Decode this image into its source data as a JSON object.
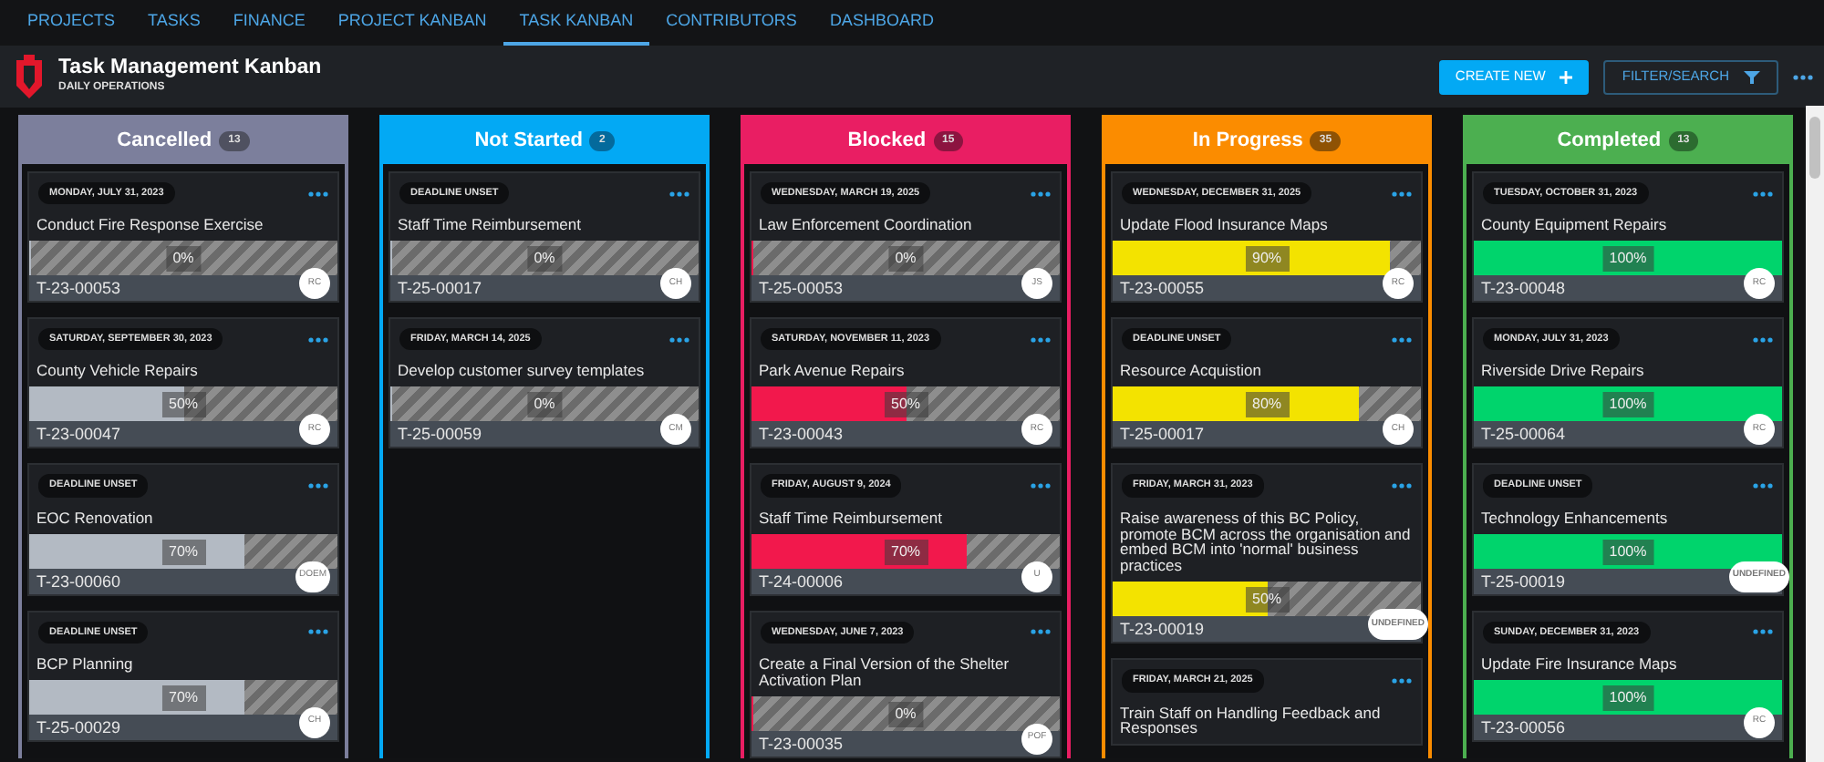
{
  "nav": {
    "tabs": [
      {
        "label": "PROJECTS",
        "selected": false
      },
      {
        "label": "TASKS",
        "selected": false
      },
      {
        "label": "FINANCE",
        "selected": false
      },
      {
        "label": "PROJECT KANBAN",
        "selected": false
      },
      {
        "label": "TASK KANBAN",
        "selected": true
      },
      {
        "label": "CONTRIBUTORS",
        "selected": false
      },
      {
        "label": "DASHBOARD",
        "selected": false
      }
    ]
  },
  "header": {
    "title": "Task Management Kanban",
    "subtitle": "DAILY OPERATIONS",
    "create_button": "CREATE NEW",
    "filter_button": "FILTER/SEARCH"
  },
  "columns": [
    {
      "name": "Cancelled",
      "count": "13",
      "color": "#7c7f9c",
      "kind": "cancelled",
      "cards": [
        {
          "date": "MONDAY, JULY 31, 2023",
          "title": "Conduct Fire Response Exercise",
          "level": 0,
          "percent": "0%",
          "id": "T-23-00053",
          "avatar": "RC"
        },
        {
          "date": "SATURDAY, SEPTEMBER 30, 2023",
          "title": "County Vehicle Repairs",
          "level": 0.5,
          "percent": "50%",
          "id": "T-23-00047",
          "avatar": "RC"
        },
        {
          "date": "DEADLINE UNSET",
          "title": "EOC Renovation",
          "level": 0.7,
          "percent": "70%",
          "id": "T-23-00060",
          "avatar": "DOEM"
        },
        {
          "date": "DEADLINE UNSET",
          "title": "BCP Planning",
          "level": 0.7,
          "percent": "70%",
          "id": "T-25-00029",
          "avatar": "CH"
        }
      ]
    },
    {
      "name": "Not Started",
      "count": "2",
      "color": "#03a9f4",
      "kind": "not_started",
      "cards": [
        {
          "date": "DEADLINE UNSET",
          "title": "Staff Time Reimbursement",
          "level": 0,
          "percent": "0%",
          "id": "T-25-00017",
          "avatar": "CH"
        },
        {
          "date": "FRIDAY, MARCH 14, 2025",
          "title": "Develop customer survey templates",
          "level": 0,
          "percent": "0%",
          "id": "T-25-00059",
          "avatar": "CM"
        }
      ]
    },
    {
      "name": "Blocked",
      "count": "15",
      "color": "#e91e63",
      "kind": "blocked",
      "cards": [
        {
          "date": "WEDNESDAY, MARCH 19, 2025",
          "title": "Law Enforcement Coordination",
          "level": 0,
          "percent": "0%",
          "id": "T-25-00053",
          "avatar": "JS"
        },
        {
          "date": "SATURDAY, NOVEMBER 11, 2023",
          "title": "Park Avenue Repairs",
          "level": 0.5,
          "percent": "50%",
          "id": "T-23-00043",
          "avatar": "RC"
        },
        {
          "date": "FRIDAY, AUGUST 9, 2024",
          "title": "Staff Time Reimbursement",
          "level": 0.7,
          "percent": "70%",
          "id": "T-24-00006",
          "avatar": "U"
        },
        {
          "date": "WEDNESDAY, JUNE 7, 2023",
          "title": "Create a Final Version of the Shelter Activation Plan",
          "level": 0,
          "percent": "0%",
          "id": "T-23-00035",
          "avatar": "POF"
        }
      ]
    },
    {
      "name": "In Progress",
      "count": "35",
      "color": "#fb8c00",
      "kind": "in_progress",
      "cards": [
        {
          "date": "WEDNESDAY, DECEMBER 31, 2025",
          "title": "Update Flood Insurance Maps",
          "level": 0.9,
          "percent": "90%",
          "id": "T-23-00055",
          "avatar": "RC"
        },
        {
          "date": "DEADLINE UNSET",
          "title": "Resource Acquistion",
          "level": 0.8,
          "percent": "80%",
          "id": "T-25-00017",
          "avatar": "CH"
        },
        {
          "date": "FRIDAY, MARCH 31, 2023",
          "title": "Raise awareness of this BC Policy, promote BCM across the organisation and embed BCM into 'normal' business practices",
          "level": 0.5,
          "percent": "50%",
          "id": "T-23-00019",
          "avatar": "UNDEFINED"
        },
        {
          "date": "FRIDAY, MARCH 21, 2025",
          "title": "Train Staff on Handling Feedback and Responses"
        }
      ]
    },
    {
      "name": "Completed",
      "count": "13",
      "color": "#4caf50",
      "kind": "completed",
      "cards": [
        {
          "date": "TUESDAY, OCTOBER 31, 2023",
          "title": "County Equipment Repairs",
          "level": 1,
          "percent": "100%",
          "id": "T-23-00048",
          "avatar": "RC"
        },
        {
          "date": "MONDAY, JULY 31, 2023",
          "title": "Riverside Drive Repairs",
          "level": 1,
          "percent": "100%",
          "id": "T-25-00064",
          "avatar": "RC"
        },
        {
          "date": "DEADLINE UNSET",
          "title": "Technology Enhancements",
          "level": 1,
          "percent": "100%",
          "id": "T-25-00019",
          "avatar": "UNDEFINED"
        },
        {
          "date": "SUNDAY, DECEMBER 31, 2023",
          "title": "Update Fire Insurance Maps",
          "level": 1,
          "percent": "100%",
          "id": "T-23-00056",
          "avatar": "RC"
        }
      ]
    }
  ]
}
